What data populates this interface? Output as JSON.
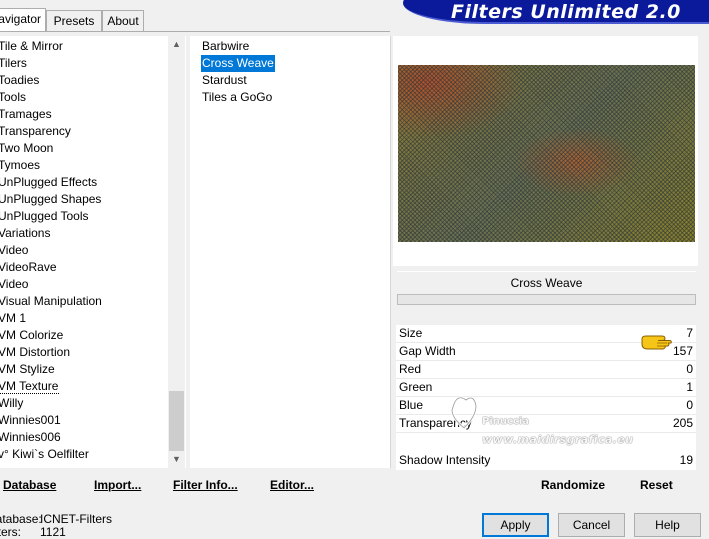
{
  "tabs": [
    "Navigator",
    "Presets",
    "About"
  ],
  "banner": "Filters Unlimited 2.0",
  "categories": [
    "Tile & Mirror",
    "Tilers",
    "Toadies",
    "Tools",
    "Tramages",
    "Transparency",
    "Two Moon",
    "Tymoes",
    "UnPlugged Effects",
    "UnPlugged Shapes",
    "UnPlugged Tools",
    "Variations",
    "Video",
    "VideoRave",
    "Video",
    "Visual Manipulation",
    "VM 1",
    "VM Colorize",
    "VM Distortion",
    "VM Stylize",
    "VM Texture",
    "Willy",
    "Winnies001",
    "Winnies006",
    "v° Kiwi`s Oelfilter"
  ],
  "selected_category": "VM Texture",
  "filters": [
    "Barbwire",
    "Cross Weave",
    "Stardust",
    "Tiles a GoGo"
  ],
  "selected_filter": "Cross Weave",
  "filter_title": "Cross Weave",
  "params": [
    {
      "label": "Size",
      "value": "7"
    },
    {
      "label": "Gap Width",
      "value": "157"
    },
    {
      "label": "Red",
      "value": "0"
    },
    {
      "label": "Green",
      "value": "1"
    },
    {
      "label": "Blue",
      "value": "0"
    },
    {
      "label": "Transparency",
      "value": "205"
    }
  ],
  "shadow": {
    "label": "Shadow Intensity",
    "value": "19"
  },
  "watermark": {
    "line1": "Pinuccia",
    "line2": "www.maidirsgrafica.eu"
  },
  "links": {
    "database": "Database",
    "import": "Import...",
    "filter_info": "Filter Info...",
    "editor": "Editor...",
    "randomize": "Randomize",
    "reset": "Reset"
  },
  "info": {
    "database_label": "Database:",
    "database_value": "ICNET-Filters",
    "filters_label": "Filters:",
    "filters_value": "1121"
  },
  "buttons": {
    "apply": "Apply",
    "cancel": "Cancel",
    "help": "Help"
  },
  "colors": {
    "selection": "#0078d7",
    "banner": "#0a1a9a"
  }
}
